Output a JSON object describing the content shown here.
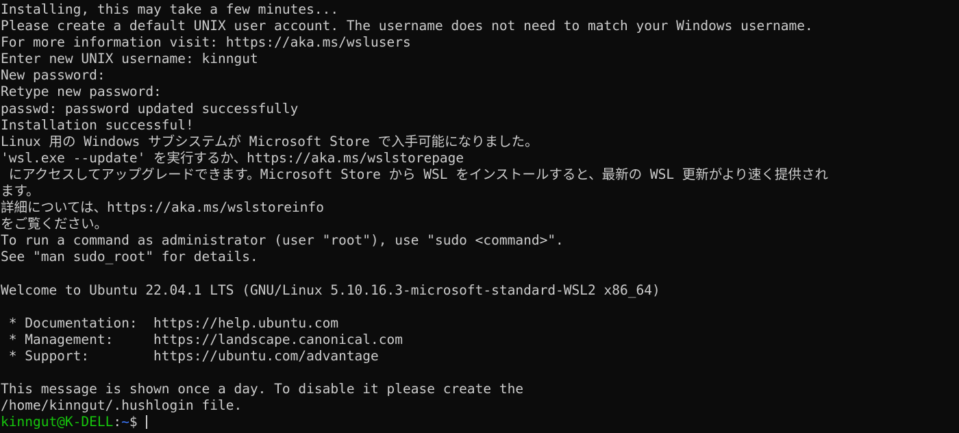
{
  "terminal": {
    "lines": [
      "Installing, this may take a few minutes...",
      "Please create a default UNIX user account. The username does not need to match your Windows username.",
      "For more information visit: https://aka.ms/wslusers",
      "Enter new UNIX username: kinngut",
      "New password:",
      "Retype new password:",
      "passwd: password updated successfully",
      "Installation successful!",
      "Linux 用の Windows サブシステムが Microsoft Store で入手可能になりました。",
      "'wsl.exe --update' を実行するか、https://aka.ms/wslstorepage",
      " にアクセスしてアップグレードできます。Microsoft Store から WSL をインストールすると、最新の WSL 更新がより速く提供され",
      "ます。",
      "詳細については、https://aka.ms/wslstoreinfo",
      "をご覧ください。",
      "To run a command as administrator (user \"root\"), use \"sudo <command>\".",
      "See \"man sudo_root\" for details.",
      "",
      "Welcome to Ubuntu 22.04.1 LTS (GNU/Linux 5.10.16.3-microsoft-standard-WSL2 x86_64)",
      "",
      " * Documentation:  https://help.ubuntu.com",
      " * Management:     https://landscape.canonical.com",
      " * Support:        https://ubuntu.com/advantage",
      "",
      "This message is shown once a day. To disable it please create the",
      "/home/kinngut/.hushlogin file."
    ],
    "prompt": {
      "user_host": "kinngut@K-DELL",
      "separator": ":",
      "path": "~",
      "symbol": "$ "
    }
  },
  "colors": {
    "background": "#0c0c0c",
    "foreground": "#cccccc",
    "prompt_user": "#16c60c",
    "prompt_path": "#3b78ff"
  }
}
